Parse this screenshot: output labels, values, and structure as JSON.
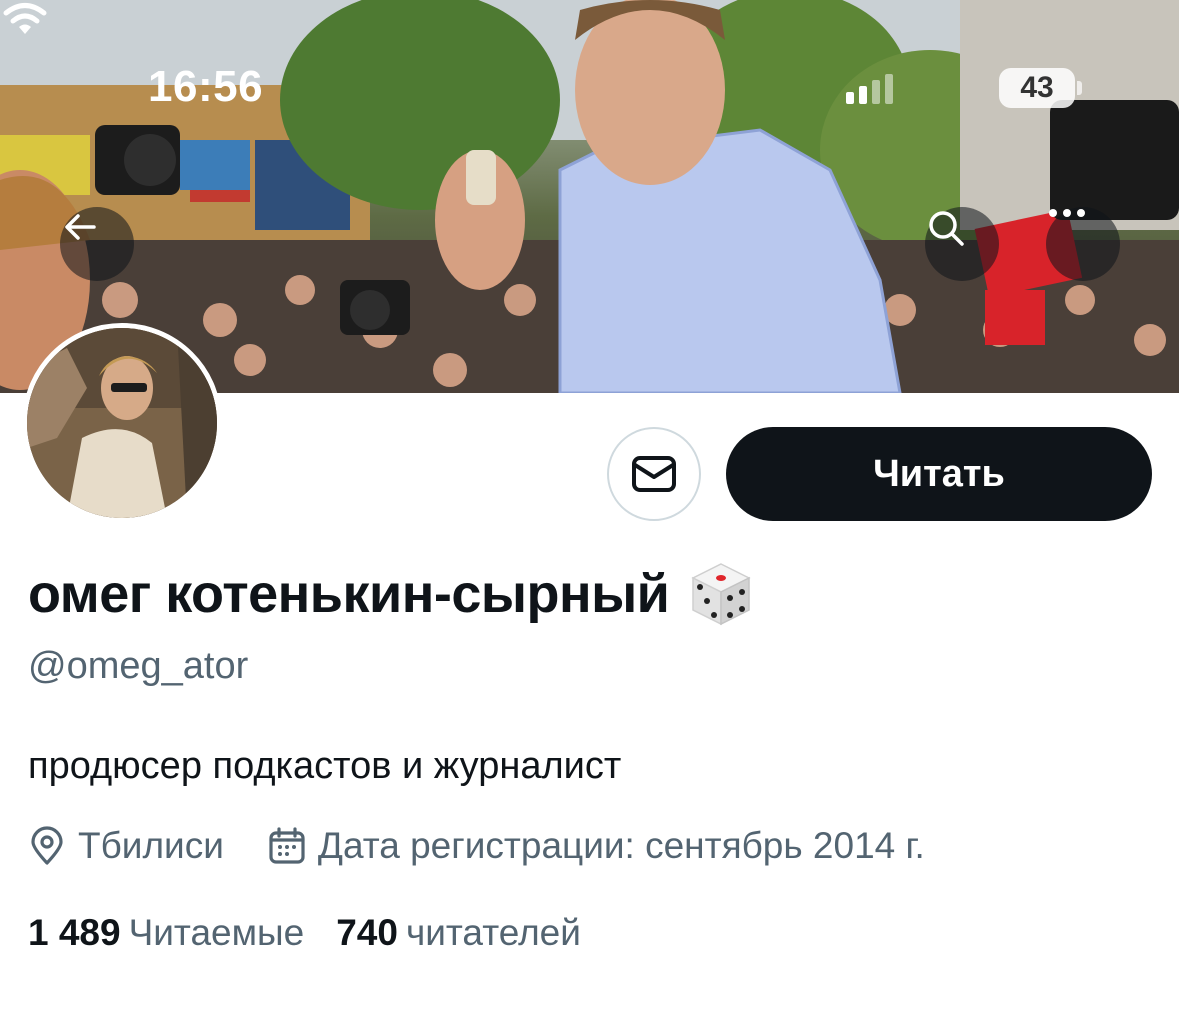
{
  "status_bar": {
    "time": "16:56",
    "battery": "43"
  },
  "banner": {
    "image": "protest-crowd-photo"
  },
  "nav": {
    "back_icon": "arrow-left-icon",
    "search_icon": "search-icon",
    "more_icon": "more-icon"
  },
  "profile": {
    "avatar": "profile-avatar-photo",
    "display_name": "омег котенькин-сырный",
    "emoji": "🎲",
    "username": "@omeg_ator",
    "bio": "продюсер подкастов и журналист",
    "location": "Тбилиси",
    "joined": "Дата регистрации: сентябрь 2014 г.",
    "following_count": "1 489",
    "following_label": "Читаемые",
    "followers_count": "740",
    "followers_label": "читателей"
  },
  "actions": {
    "message_icon": "envelope-icon",
    "follow_label": "Читать"
  },
  "colors": {
    "primary_text": "#0f1419",
    "secondary_text": "#536471",
    "button_bg": "#0f1419",
    "border": "#cfd9de"
  }
}
